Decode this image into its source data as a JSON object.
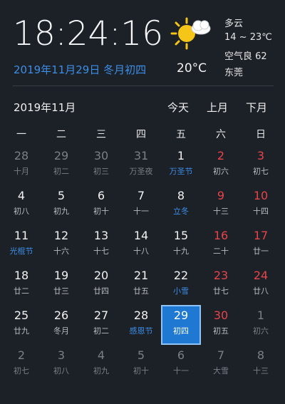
{
  "header": {
    "time": "18:24:16",
    "date_line": "2019年11月29日 冬月初四"
  },
  "weather": {
    "icon": "sun-cloud-icon",
    "temperature": "20°C",
    "description": "多云",
    "range": "14 ~ 23℃",
    "air_quality": "空气良 62",
    "city": "东莞"
  },
  "calendar": {
    "month_title": "2019年11月",
    "nav": {
      "today": "今天",
      "prev": "上月",
      "next": "下月"
    },
    "weekdays": [
      "一",
      "二",
      "三",
      "四",
      "五",
      "六",
      "日"
    ],
    "selected": "29",
    "weeks": [
      [
        {
          "day": "28",
          "lunar": "十月",
          "day_style": "gray",
          "lunar_style": "dim"
        },
        {
          "day": "29",
          "lunar": "初二",
          "day_style": "gray",
          "lunar_style": "dim"
        },
        {
          "day": "30",
          "lunar": "初三",
          "day_style": "gray",
          "lunar_style": "dim"
        },
        {
          "day": "31",
          "lunar": "万圣夜",
          "day_style": "gray",
          "lunar_style": "dim"
        },
        {
          "day": "1",
          "lunar": "万圣节",
          "day_style": "white",
          "lunar_style": "blue"
        },
        {
          "day": "2",
          "lunar": "初六",
          "day_style": "red",
          "lunar_style": "gray"
        },
        {
          "day": "3",
          "lunar": "初七",
          "day_style": "red",
          "lunar_style": "gray"
        }
      ],
      [
        {
          "day": "4",
          "lunar": "初八",
          "day_style": "white",
          "lunar_style": "gray"
        },
        {
          "day": "5",
          "lunar": "初九",
          "day_style": "white",
          "lunar_style": "gray"
        },
        {
          "day": "6",
          "lunar": "初十",
          "day_style": "white",
          "lunar_style": "gray"
        },
        {
          "day": "7",
          "lunar": "十一",
          "day_style": "white",
          "lunar_style": "gray"
        },
        {
          "day": "8",
          "lunar": "立冬",
          "day_style": "white",
          "lunar_style": "blue"
        },
        {
          "day": "9",
          "lunar": "十三",
          "day_style": "red",
          "lunar_style": "gray"
        },
        {
          "day": "10",
          "lunar": "十四",
          "day_style": "red",
          "lunar_style": "gray"
        }
      ],
      [
        {
          "day": "11",
          "lunar": "光棍节",
          "day_style": "white",
          "lunar_style": "blue"
        },
        {
          "day": "12",
          "lunar": "十六",
          "day_style": "white",
          "lunar_style": "gray"
        },
        {
          "day": "13",
          "lunar": "十七",
          "day_style": "white",
          "lunar_style": "gray"
        },
        {
          "day": "14",
          "lunar": "十八",
          "day_style": "white",
          "lunar_style": "gray"
        },
        {
          "day": "15",
          "lunar": "十九",
          "day_style": "white",
          "lunar_style": "gray"
        },
        {
          "day": "16",
          "lunar": "二十",
          "day_style": "red",
          "lunar_style": "gray"
        },
        {
          "day": "17",
          "lunar": "廿一",
          "day_style": "red",
          "lunar_style": "gray"
        }
      ],
      [
        {
          "day": "18",
          "lunar": "廿二",
          "day_style": "white",
          "lunar_style": "gray"
        },
        {
          "day": "19",
          "lunar": "廿三",
          "day_style": "white",
          "lunar_style": "gray"
        },
        {
          "day": "20",
          "lunar": "廿四",
          "day_style": "white",
          "lunar_style": "gray"
        },
        {
          "day": "21",
          "lunar": "廿五",
          "day_style": "white",
          "lunar_style": "gray"
        },
        {
          "day": "22",
          "lunar": "小雪",
          "day_style": "white",
          "lunar_style": "blue"
        },
        {
          "day": "23",
          "lunar": "廿七",
          "day_style": "red",
          "lunar_style": "gray"
        },
        {
          "day": "24",
          "lunar": "廿八",
          "day_style": "red",
          "lunar_style": "gray"
        }
      ],
      [
        {
          "day": "25",
          "lunar": "廿九",
          "day_style": "white",
          "lunar_style": "gray"
        },
        {
          "day": "26",
          "lunar": "冬月",
          "day_style": "white",
          "lunar_style": "gray"
        },
        {
          "day": "27",
          "lunar": "初二",
          "day_style": "white",
          "lunar_style": "gray"
        },
        {
          "day": "28",
          "lunar": "感恩节",
          "day_style": "white",
          "lunar_style": "blue"
        },
        {
          "day": "29",
          "lunar": "初四",
          "day_style": "white",
          "lunar_style": "gray"
        },
        {
          "day": "30",
          "lunar": "初五",
          "day_style": "red",
          "lunar_style": "gray"
        },
        {
          "day": "1",
          "lunar": "初六",
          "day_style": "gray",
          "lunar_style": "dim"
        }
      ],
      [
        {
          "day": "2",
          "lunar": "初七",
          "day_style": "gray",
          "lunar_style": "dim"
        },
        {
          "day": "3",
          "lunar": "初八",
          "day_style": "gray",
          "lunar_style": "dim"
        },
        {
          "day": "4",
          "lunar": "初九",
          "day_style": "gray",
          "lunar_style": "dim"
        },
        {
          "day": "5",
          "lunar": "初十",
          "day_style": "gray",
          "lunar_style": "dim"
        },
        {
          "day": "6",
          "lunar": "十一",
          "day_style": "gray",
          "lunar_style": "dim"
        },
        {
          "day": "7",
          "lunar": "大雪",
          "day_style": "gray",
          "lunar_style": "dim"
        },
        {
          "day": "8",
          "lunar": "十三",
          "day_style": "gray",
          "lunar_style": "dim"
        }
      ]
    ]
  }
}
